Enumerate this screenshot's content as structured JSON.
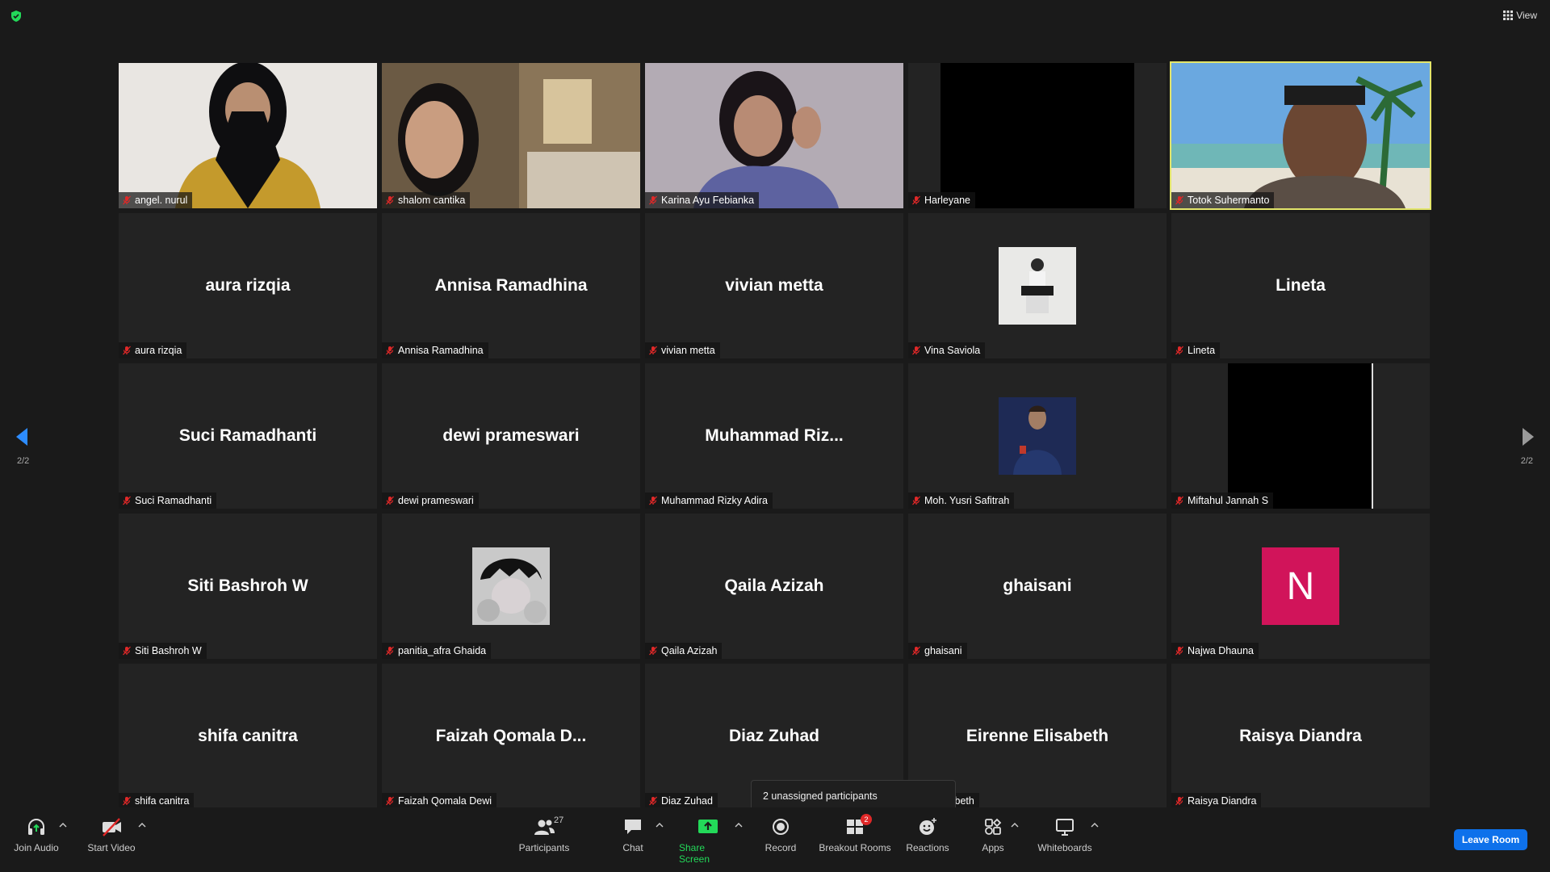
{
  "top": {
    "view_label": "View"
  },
  "pagination": {
    "left_indicator": "2/2",
    "right_indicator": "2/2"
  },
  "tiles": [
    {
      "name": "angel. nurul",
      "type": "video"
    },
    {
      "name": "shalom cantika",
      "type": "video"
    },
    {
      "name": "Karina Ayu Febianka",
      "type": "video"
    },
    {
      "name": "Harleyane",
      "type": "video-black"
    },
    {
      "name": "Totok Suhermanto",
      "type": "video",
      "speaking": true
    },
    {
      "name": "aura rizqia",
      "big": "aura rizqia"
    },
    {
      "name": "Annisa Ramadhina",
      "big": "Annisa Ramadhina"
    },
    {
      "name": "vivian metta",
      "big": "vivian metta"
    },
    {
      "name": "Vina Saviola",
      "type": "photo"
    },
    {
      "name": "Lineta",
      "big": "Lineta"
    },
    {
      "name": "Suci Ramadhanti",
      "big": "Suci Ramadhanti"
    },
    {
      "name": "dewi prameswari",
      "big": "dewi prameswari"
    },
    {
      "name": "Muhammad Rizky Adira",
      "big": "Muhammad  Riz..."
    },
    {
      "name": "Moh. Yusri Safitrah",
      "type": "photo"
    },
    {
      "name": "Miftahul Jannah S",
      "type": "video-black"
    },
    {
      "name": "Siti Bashroh W",
      "big": "Siti Bashroh W"
    },
    {
      "name": "panitia_afra Ghaida",
      "type": "photo"
    },
    {
      "name": "Qaila Azizah",
      "big": "Qaila Azizah"
    },
    {
      "name": "ghaisani",
      "big": "ghaisani"
    },
    {
      "name": "Najwa Dhauna",
      "type": "letter",
      "letter": "N"
    },
    {
      "name": "shifa canitra",
      "big": "shifa canitra"
    },
    {
      "name": "Faizah Qomala Dewi",
      "big": "Faizah Qomala D..."
    },
    {
      "name": "Diaz Zuhad",
      "big": "Diaz Zuhad"
    },
    {
      "name": "e Elisabeth",
      "big": "Eirenne Elisabeth"
    },
    {
      "name": "Raisya Diandra",
      "big": "Raisya Diandra"
    }
  ],
  "tooltip": {
    "text": "2 unassigned participants"
  },
  "toolbar": {
    "join_audio": "Join Audio",
    "start_video": "Start Video",
    "participants": "Participants",
    "participants_count": "27",
    "chat": "Chat",
    "share_screen": "Share Screen",
    "record": "Record",
    "breakout_rooms": "Breakout Rooms",
    "breakout_badge": "2",
    "reactions": "Reactions",
    "apps": "Apps",
    "whiteboards": "Whiteboards",
    "leave_room": "Leave Room"
  },
  "colors": {
    "accent": "#0e71eb",
    "share_green": "#23d959",
    "speaker_outline": "#e3e56b",
    "avatar_pink": "#d1145a"
  }
}
